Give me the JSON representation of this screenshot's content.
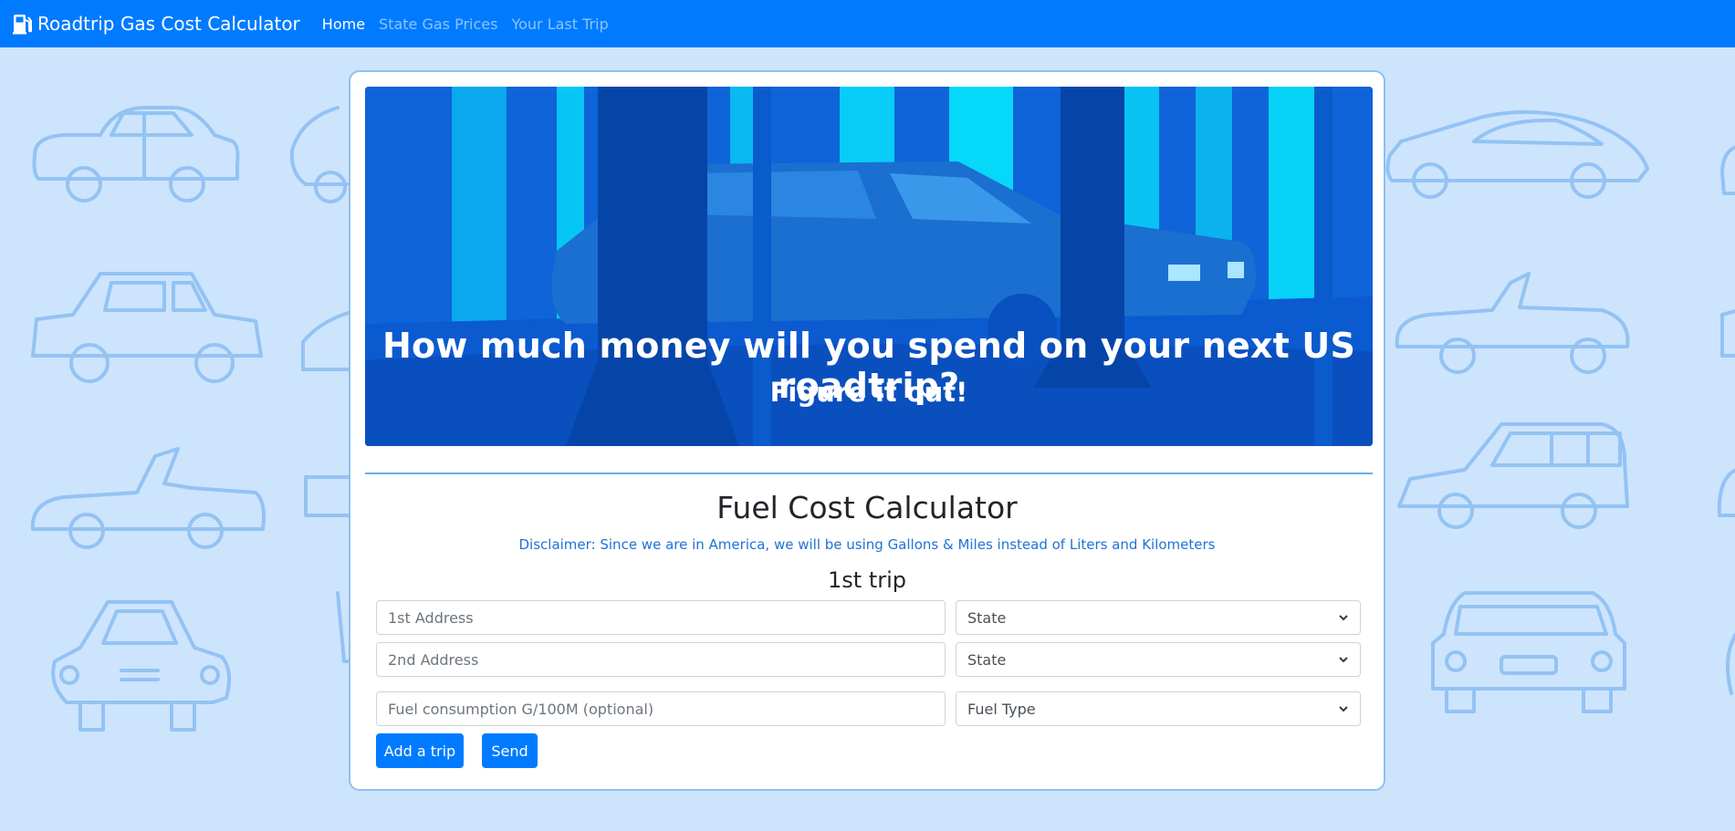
{
  "navbar": {
    "brand": "Roadtrip Gas Cost Calculator",
    "brand_icon": "gas-pump-icon",
    "links": [
      {
        "label": "Home",
        "active": true
      },
      {
        "label": "State Gas Prices",
        "active": false
      },
      {
        "label": "Your Last Trip",
        "active": false
      }
    ]
  },
  "hero": {
    "title": "How much money will you spend on your next US roadtrip?",
    "subtitle": "Figure it out!"
  },
  "calculator": {
    "title": "Fuel Cost Calculator",
    "disclaimer": "Disclaimer: Since we are in America, we will be using Gallons & Miles instead of Liters and Kilometers",
    "trip_title": "1st trip",
    "address1_placeholder": "1st Address",
    "state1_value": "State",
    "address2_placeholder": "2nd Address",
    "state2_value": "State",
    "consumption_placeholder": "Fuel consumption G/100M (optional)",
    "fuel_type_value": "Fuel Type",
    "add_trip_label": "Add a trip",
    "send_label": "Send"
  },
  "colors": {
    "navbar": "#007bff",
    "background": "#cde4fd",
    "disclaimer": "#1f73d6",
    "button": "#007bff"
  }
}
